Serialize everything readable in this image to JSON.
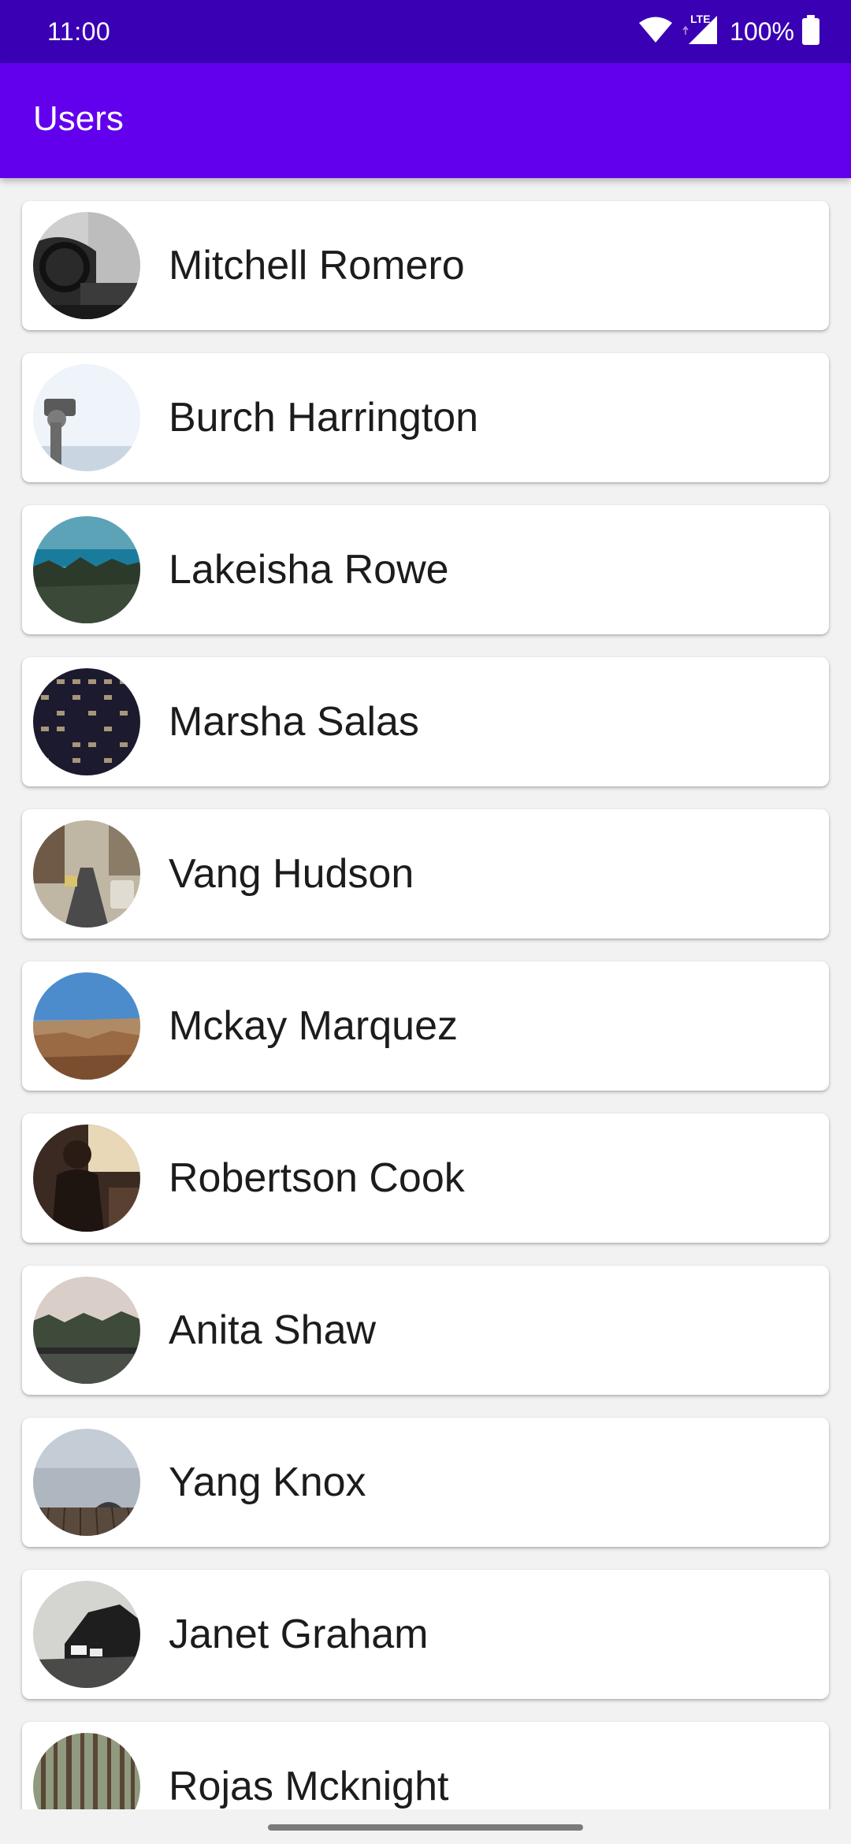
{
  "status_bar": {
    "time": "11:00",
    "network_label": "LTE",
    "battery": "100%"
  },
  "app_bar": {
    "title": "Users"
  },
  "users": [
    {
      "name": "Mitchell Romero",
      "avatar": "photo-car-interior"
    },
    {
      "name": "Burch Harrington",
      "avatar": "photo-viewing-binoculars"
    },
    {
      "name": "Lakeisha Rowe",
      "avatar": "photo-lake-forest"
    },
    {
      "name": "Marsha Salas",
      "avatar": "photo-city-building-night"
    },
    {
      "name": "Vang Hudson",
      "avatar": "photo-city-street"
    },
    {
      "name": "Mckay Marquez",
      "avatar": "photo-canyon-landscape"
    },
    {
      "name": "Robertson Cook",
      "avatar": "photo-person-sunset"
    },
    {
      "name": "Anita Shaw",
      "avatar": "photo-misty-bridge"
    },
    {
      "name": "Yang Knox",
      "avatar": "photo-foggy-pier"
    },
    {
      "name": "Janet Graham",
      "avatar": "photo-coastal-village"
    },
    {
      "name": "Rojas Mcknight",
      "avatar": "photo-pine-forest"
    }
  ]
}
